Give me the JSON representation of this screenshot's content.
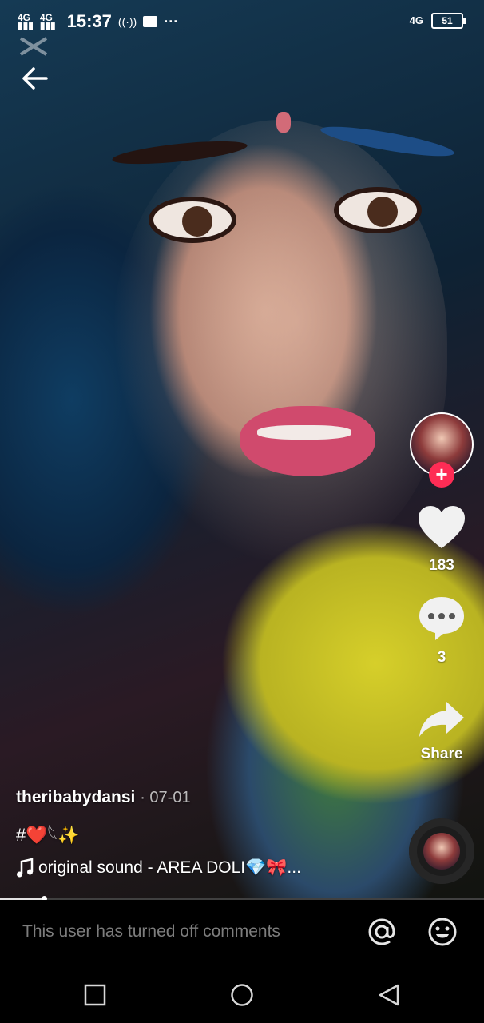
{
  "status_bar": {
    "signal_1": "4G",
    "signal_2": "4G",
    "time": "15:37",
    "network": "4G",
    "battery": "51"
  },
  "post": {
    "username": "theribabydansi",
    "date": "· 07-01",
    "hashtags": "#❤️𓆩✨",
    "sound": "original sound - AREA DOLI💎🎀...",
    "progress": 0.09
  },
  "actions": {
    "likes": "183",
    "comments": "3",
    "share_label": "Share"
  },
  "comment_bar": {
    "placeholder": "This user has turned off comments"
  },
  "colors": {
    "follow_accent": "#fe2c55",
    "comment_placeholder": "#7d7d7d"
  },
  "icons": [
    "back-arrow-icon",
    "heart-icon",
    "comment-bubble-icon",
    "share-arrow-icon",
    "music-note-icon",
    "mention-icon",
    "emoji-icon",
    "plus-icon",
    "recent-apps-icon",
    "home-icon",
    "back-triangle-icon"
  ]
}
